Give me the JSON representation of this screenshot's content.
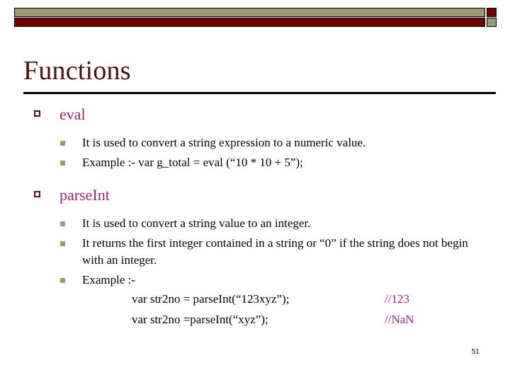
{
  "slide": {
    "title": "Functions",
    "page_number": "51",
    "colors": {
      "olive": "#9a9a6e",
      "maroon": "#700000",
      "title_text": "#4a1010",
      "heading_text": "#a02080",
      "comment_text": "#a02080",
      "body_text": "#000000"
    },
    "header_bars": {
      "top_bar_color": "#9a9a6e",
      "top_square_color": "#700000",
      "bottom_bar_color": "#700000",
      "bottom_square_color": "#9a9a6e"
    },
    "sections": [
      {
        "heading": "eval",
        "bullet_icon": "hollow-square-bullet",
        "points": [
          {
            "text": "It is used to convert a string expression to a numeric value.",
            "justify": true
          },
          {
            "text": "Example :- var g_total = eval (“10 * 10 + 5”);",
            "justify": false
          }
        ],
        "code_lines": []
      },
      {
        "heading": "parseInt",
        "bullet_icon": "hollow-square-bullet",
        "points": [
          {
            "text": "It is used to convert a string value to an integer.",
            "justify": false
          },
          {
            "text": "It returns the first integer contained in a string or “0” if the string does not begin with an integer.",
            "justify": false
          },
          {
            "text": "Example :-",
            "justify": false
          }
        ],
        "code_lines": [
          {
            "code": "var str2no = parseInt(“123xyz”);",
            "comment": "//123"
          },
          {
            "code": "var str2no =parseInt(“xyz”);",
            "comment": "//NaN"
          }
        ]
      }
    ]
  }
}
